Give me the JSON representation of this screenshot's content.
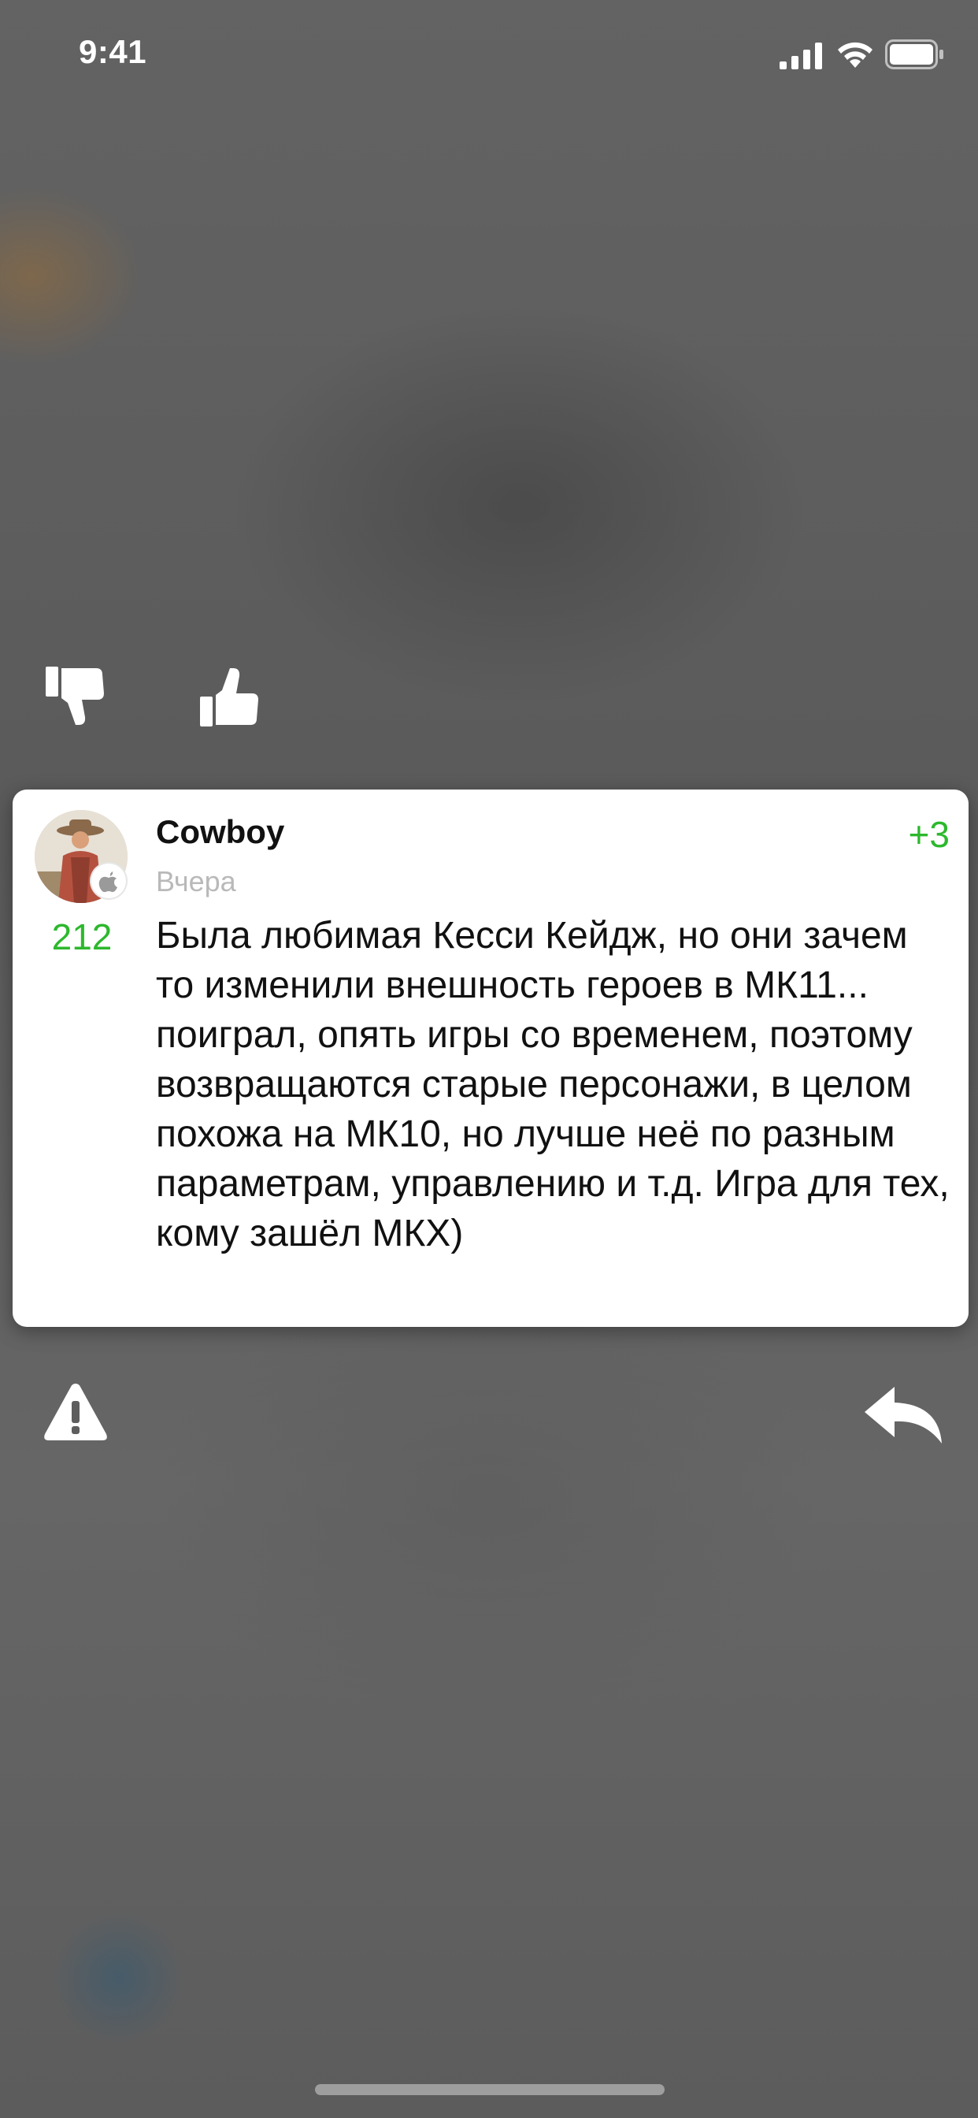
{
  "status_bar": {
    "time": "9:41",
    "icons": [
      "signal-icon",
      "wifi-icon",
      "battery-icon"
    ]
  },
  "vote": {
    "dislike_icon": "thumbs-down-icon",
    "like_icon": "thumbs-up-icon"
  },
  "comment": {
    "author": "Cowboy",
    "date": "Вчера",
    "author_rating": "212",
    "score": "+3",
    "text": "Была любимая Кесси Кейдж, но они зачем то изменили внешность героев в МК11... поиграл, опять игры со временем, поэтому возвращаются старые персонажи, в целом похожа на МК10, но лучше неё по разным параметрам, управлению и т.д. Игра для тех, кому зашёл МКХ)",
    "platform_badge": "apple-icon"
  },
  "actions": {
    "report_icon": "warning-icon",
    "reply_icon": "reply-icon"
  },
  "colors": {
    "accent_green": "#2db82d",
    "card_background": "#ffffff",
    "overlay_background": "#5e5e5e",
    "date_gray": "#b9b9b9"
  }
}
